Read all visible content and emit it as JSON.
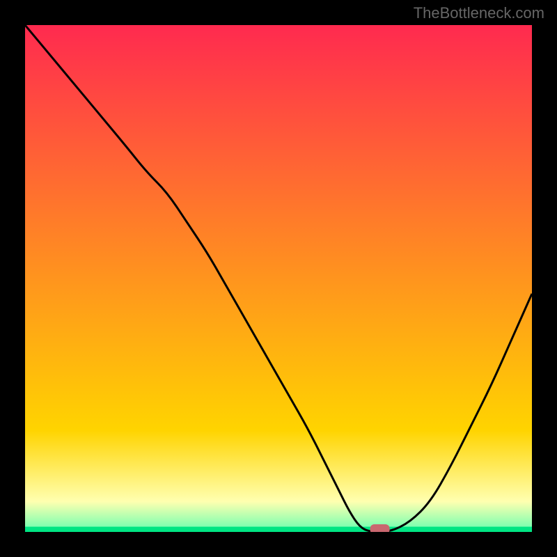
{
  "watermark": "TheBottleneck.com",
  "colors": {
    "bg": "#000000",
    "top_gradient": "#ff2a4f",
    "mid_gradient": "#ffd400",
    "pale_yellow": "#ffffb0",
    "green": "#00e583",
    "curve": "#000000",
    "marker": "#c9676f"
  },
  "chart_data": {
    "type": "line",
    "title": "",
    "xlabel": "",
    "ylabel": "",
    "xlim": [
      0,
      100
    ],
    "ylim": [
      0,
      100
    ],
    "grid": false,
    "legend": false,
    "annotations": [],
    "series": [
      {
        "name": "bottleneck-curve",
        "x": [
          0,
          5,
          10,
          15,
          20,
          24,
          28,
          32,
          36,
          40,
          44,
          48,
          52,
          56,
          60,
          62,
          64,
          66,
          68,
          72,
          76,
          80,
          84,
          88,
          92,
          96,
          100
        ],
        "y": [
          100,
          94,
          88,
          82,
          76,
          71,
          67,
          61,
          55,
          48,
          41,
          34,
          27,
          20,
          12,
          8,
          4,
          1,
          0,
          0,
          2,
          6,
          13,
          21,
          29,
          38,
          47
        ]
      }
    ],
    "marker": {
      "x": 70,
      "y": 0
    },
    "gradient_bands": [
      {
        "from_y": 100,
        "to_y": 20,
        "color_top": "#ff2a4f",
        "color_bottom": "#ffd400"
      },
      {
        "from_y": 20,
        "to_y": 6,
        "color_top": "#ffd400",
        "color_bottom": "#ffffb0"
      },
      {
        "from_y": 6,
        "to_y": 1,
        "color_top": "#ffffb0",
        "color_bottom": "#7fffb0"
      },
      {
        "from_y": 1,
        "to_y": 0,
        "color_top": "#00e583",
        "color_bottom": "#00e583"
      }
    ]
  }
}
